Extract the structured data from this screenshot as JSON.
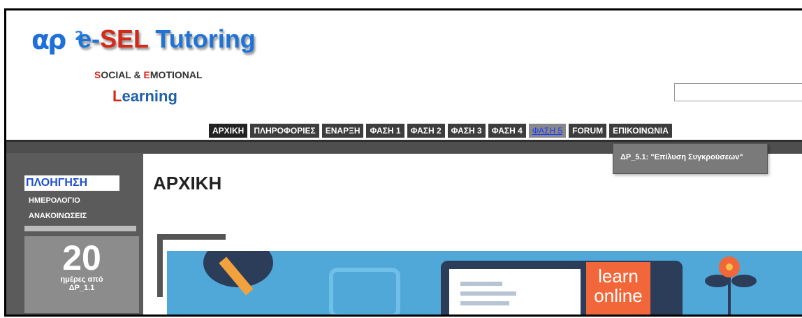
{
  "header": {
    "logo_ap": "αρ",
    "logo_sup": "2",
    "title_e": "e-",
    "title_sel": "SEL",
    "title_tutoring": " Tutoring",
    "sub_s": "S",
    "sub_ocial": "OCIAL & ",
    "sub_e": "E",
    "sub_motional": "MOTIONAL",
    "learning_l": "L",
    "learning_rest": "earning"
  },
  "search": {
    "value": ""
  },
  "nav": {
    "items": [
      "ΑΡΧΙΚΗ",
      "ΠΛΗΡΟΦΟΡΙΕΣ",
      "ΕΝΑΡΞΗ",
      "ΦΑΣΗ 1",
      "ΦΑΣΗ 2",
      "ΦΑΣΗ 3",
      "ΦΑΣΗ 4",
      "ΦΑΣΗ 5",
      "FORUM",
      "ΕΠΙΚΟΙΝΩΝΙΑ"
    ],
    "active": "ΦΑΣΗ 5",
    "dropdown_item": "ΔΡ_5.1: \"Επίλυση Συγκρούσεων\""
  },
  "sidebar": {
    "heading": "ΠΛΟΗΓΗΣΗ",
    "links": [
      "ΗΜΕΡΟΛΟΓΙΟ",
      "ΑΝΑΚΟΙΝΩΣΕΙΣ"
    ],
    "days_number": "20",
    "days_label": "ημέρες από",
    "days_ref": "ΔΡ_1.1"
  },
  "main": {
    "page_title": "ΑΡΧΙΚΗ",
    "banner_text_1": "learn",
    "banner_text_2": "online"
  },
  "colors": {
    "brand_blue": "#1e73d8",
    "brand_red": "#d42a1a",
    "nav_bg": "#3d3d3d",
    "sidebar_bg": "#5b5b5b",
    "banner_bg": "#4fa8d8"
  }
}
